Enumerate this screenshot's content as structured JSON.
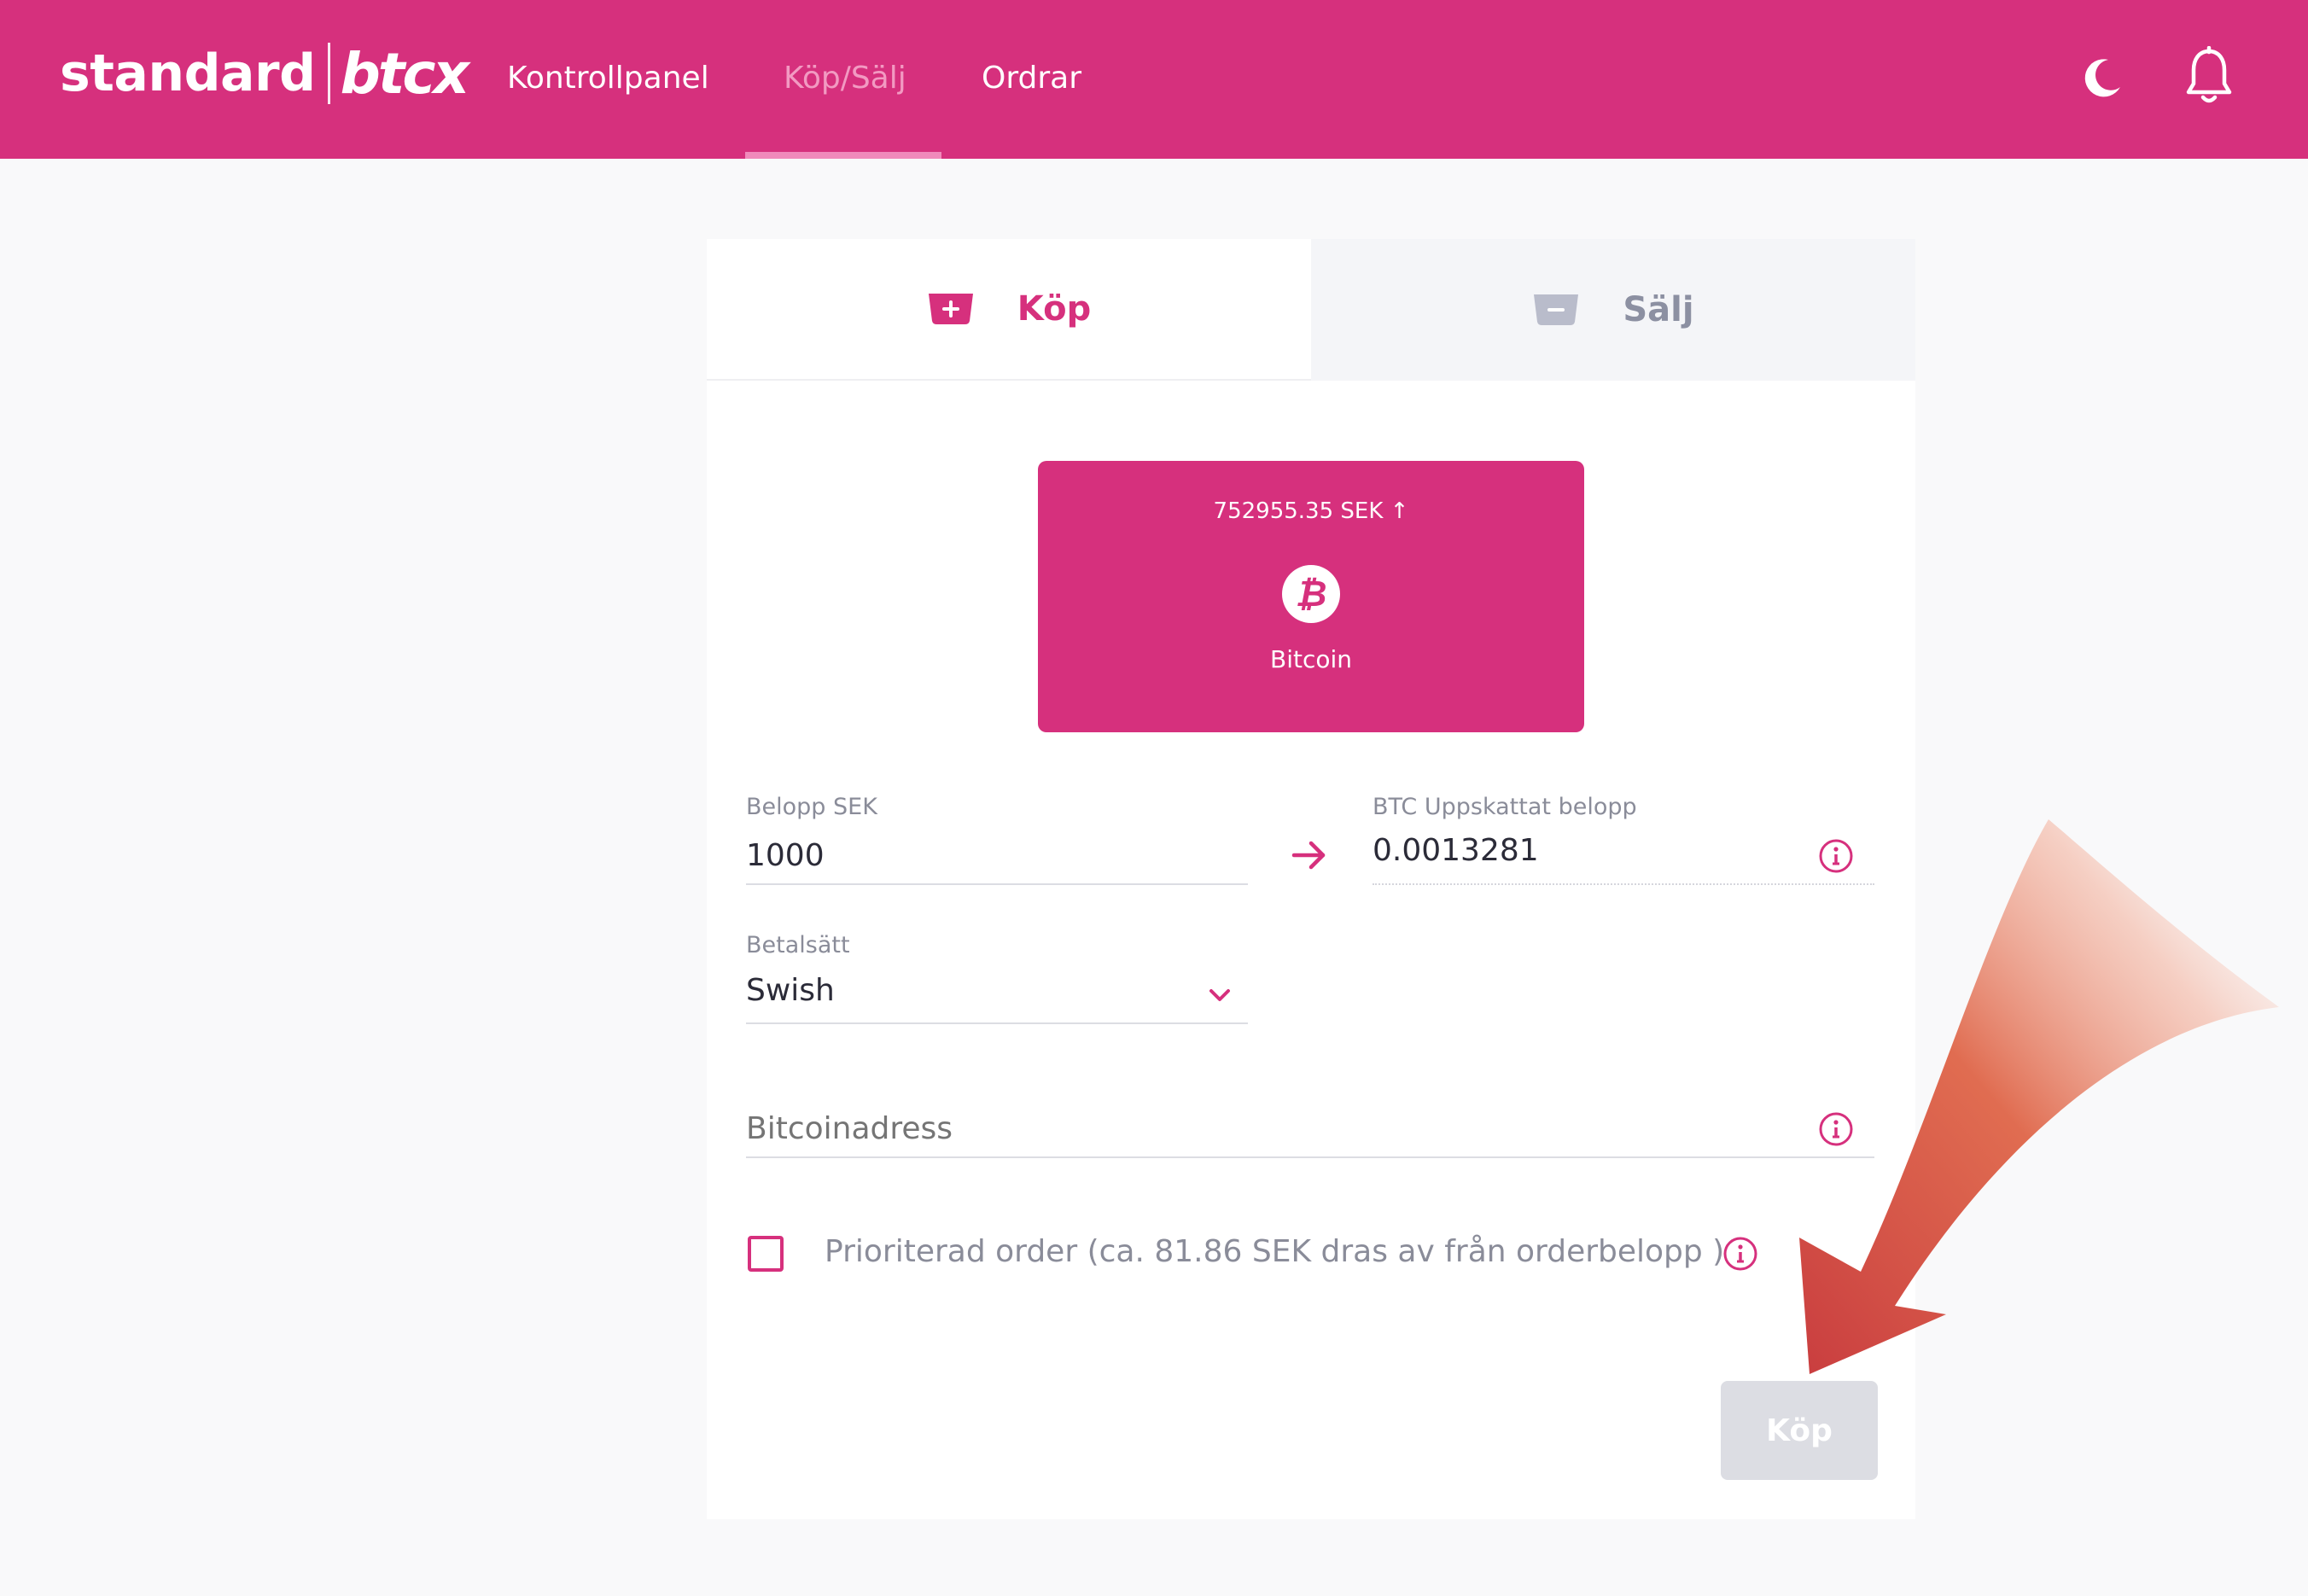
{
  "header": {
    "logo_standard": "standard",
    "logo_btcx": "btcx",
    "nav": {
      "kontrollpanel": "Kontrollpanel",
      "kop_salj": "Köp/Sälj",
      "ordrar": "Ordrar"
    },
    "active_nav": "Köp/Sälj"
  },
  "tabs": {
    "kop": "Köp",
    "salj": "Sälj",
    "active": "Köp"
  },
  "coin": {
    "price": "752955.35 SEK",
    "name": "Bitcoin"
  },
  "form": {
    "amount_label": "Belopp SEK",
    "amount_value": "1000",
    "estimate_label": "BTC Uppskattat belopp",
    "estimate_value": "0.0013281",
    "payment_label": "Betalsätt",
    "payment_value": "Swish",
    "address_placeholder": "Bitcoinadress",
    "priority_label": "Prioriterad order (ca. 81.86 SEK dras av från orderbelopp )",
    "priority_checked": false,
    "buy_button": "Köp"
  },
  "colors": {
    "brand": "#d6307d",
    "nav_active": "#f29ac2",
    "disabled_button": "#dcdde3",
    "annotation_arrow": "#d9533f"
  }
}
